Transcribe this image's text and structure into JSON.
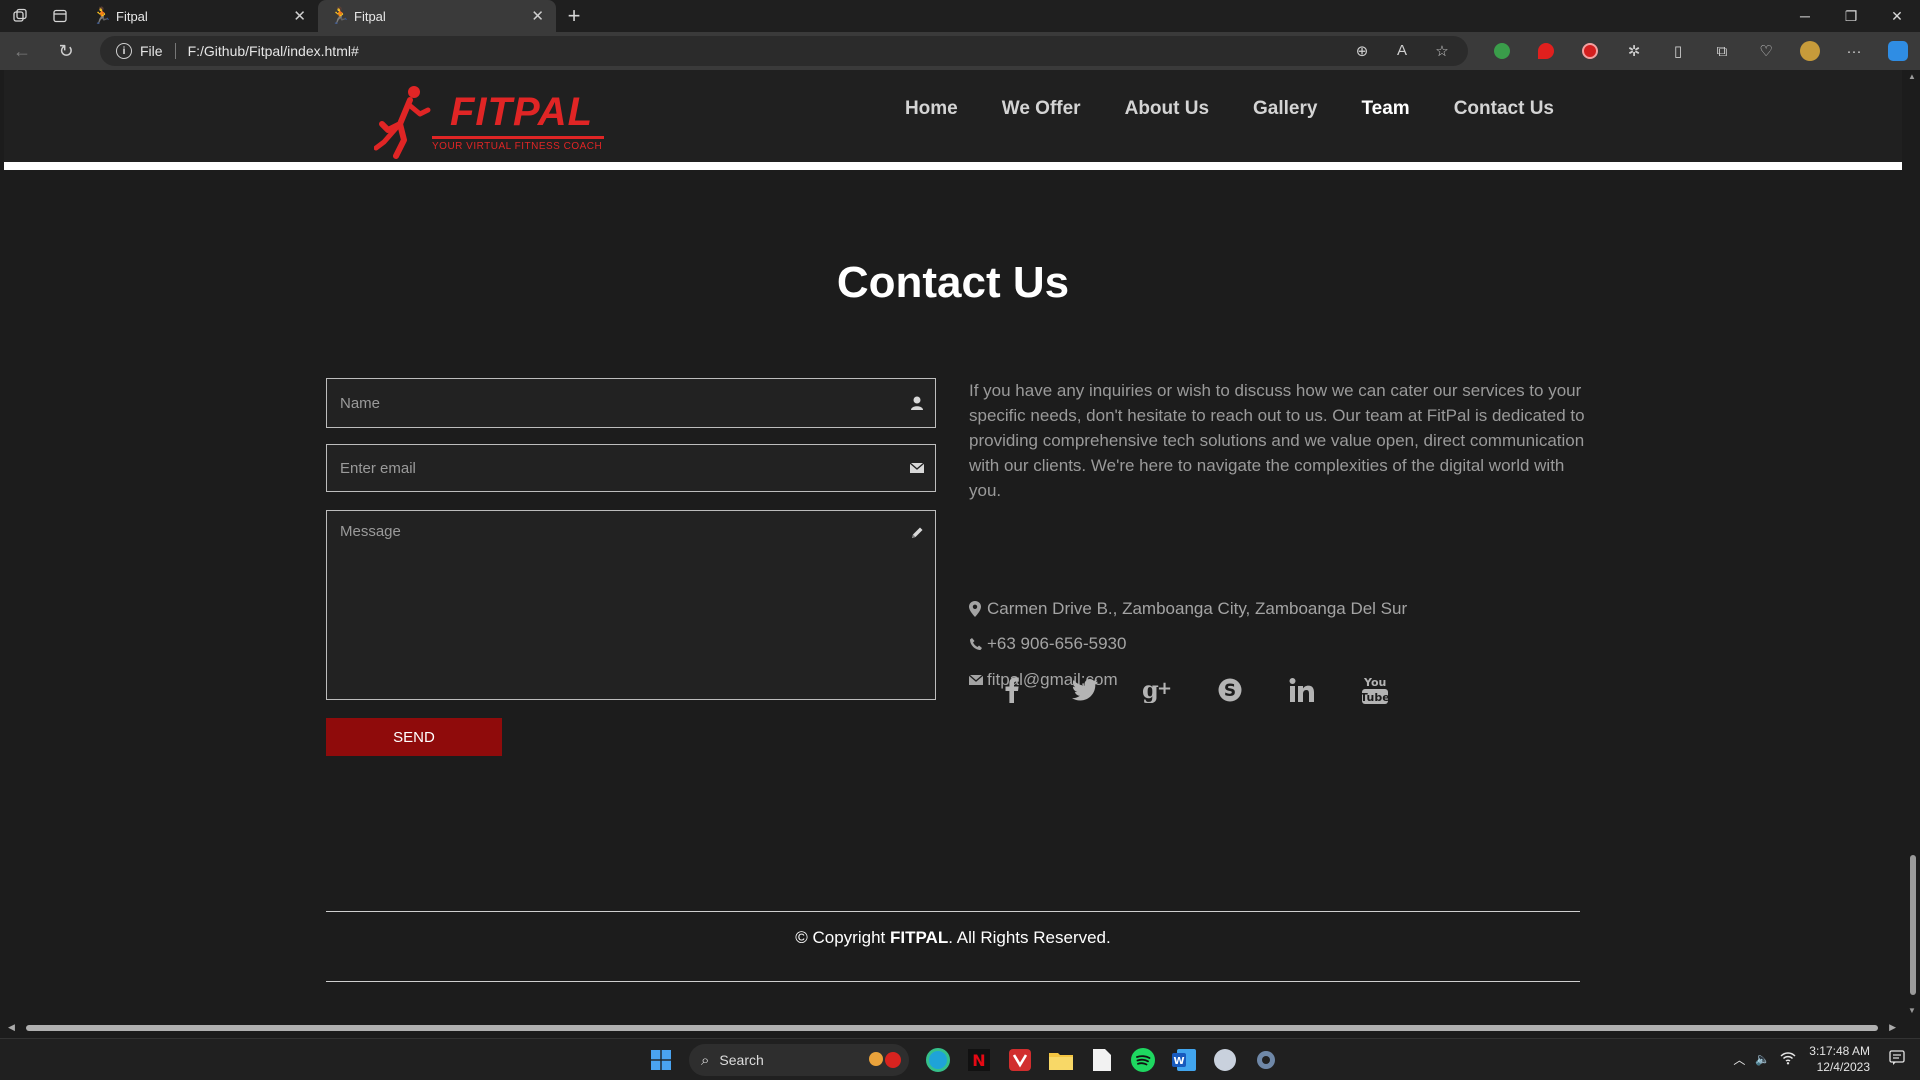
{
  "browser": {
    "tabs": [
      {
        "title": "Fitpal",
        "active": false
      },
      {
        "title": "Fitpal",
        "active": true
      }
    ],
    "address_scheme": "File",
    "address_url": "F:/Github/Fitpal/index.html#"
  },
  "site": {
    "logo": {
      "brand": "FITPAL",
      "tagline": "YOUR VIRTUAL FITNESS COACH"
    },
    "nav": [
      {
        "label": "Home",
        "active": false
      },
      {
        "label": "We Offer",
        "active": false
      },
      {
        "label": "About Us",
        "active": false
      },
      {
        "label": "Gallery",
        "active": false
      },
      {
        "label": "Team",
        "active": true
      },
      {
        "label": "Contact Us",
        "active": false
      }
    ],
    "page_title": "Contact Us",
    "form": {
      "name_placeholder": "Name",
      "email_placeholder": "Enter email",
      "message_placeholder": "Message",
      "send_label": "SEND"
    },
    "about_text": "If you have any inquiries or wish to discuss how we can cater our services to your specific needs, don't hesitate to reach out to us. Our team at FitPal is dedicated to providing comprehensive tech solutions and we value open, direct communication with our clients. We're here to navigate the complexities of the digital world with you.",
    "address": "Carmen Drive B., Zamboanga City, Zamboanga Del Sur",
    "phone": "+63 906-656-5930",
    "email": "fitpal@gmail;com",
    "socials": [
      "facebook-icon",
      "twitter-icon",
      "google-plus-icon",
      "skype-icon",
      "linkedin-icon",
      "youtube-icon"
    ],
    "copyright_prefix": "© Copyright ",
    "copyright_brand": "FITPAL",
    "copyright_suffix": ". All Rights Reserved."
  },
  "taskbar": {
    "search_label": "Search",
    "time": "3:17:48 AM",
    "date": "12/4/2023"
  },
  "colors": {
    "accent_red": "#e02525",
    "send_button": "#8f0b0b",
    "background": "#1c1c1c"
  }
}
